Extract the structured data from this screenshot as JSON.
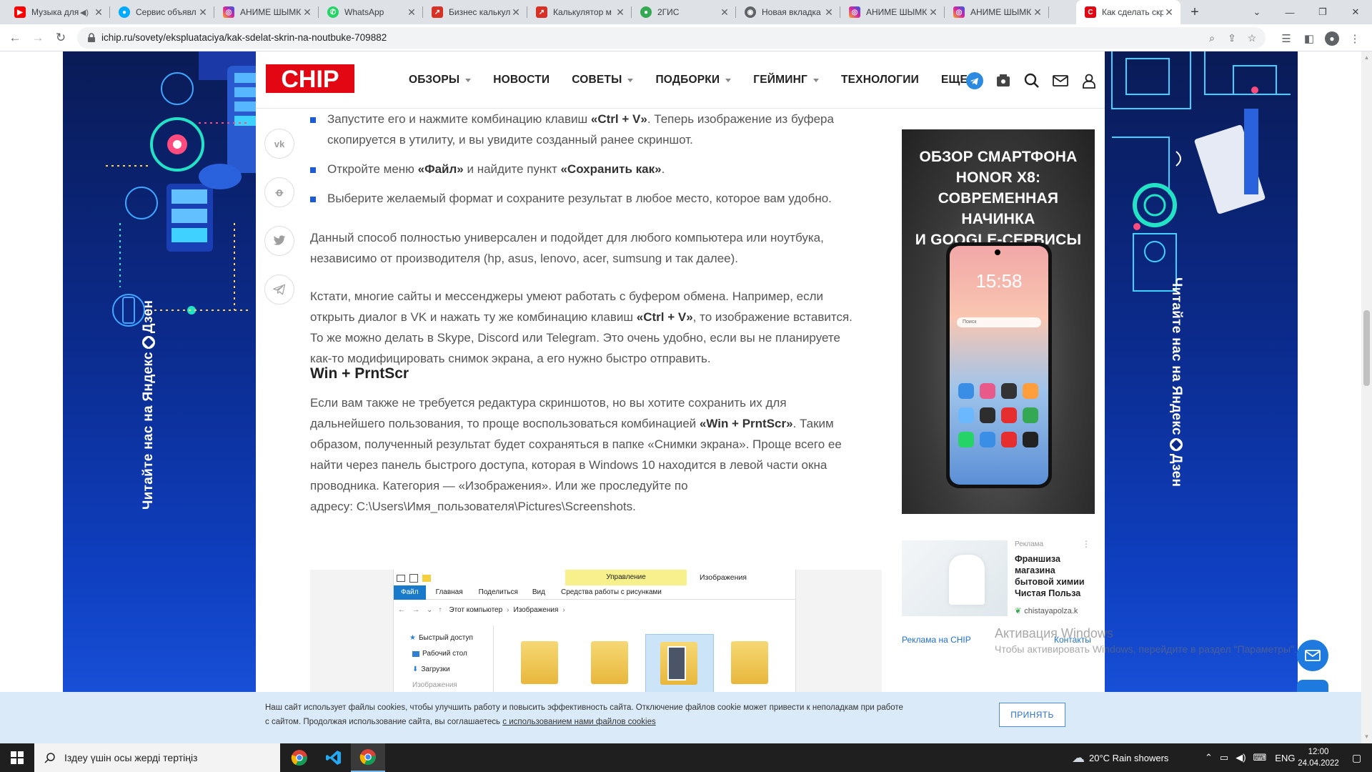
{
  "tabs": [
    {
      "title": "Музыка для",
      "icon": "youtube-icon",
      "color": "#ff0000",
      "audio": true
    },
    {
      "title": "Сервис объявл",
      "icon": "avito-icon",
      "color": "#00aaff"
    },
    {
      "title": "АНИМЕ ШЫМК",
      "icon": "instagram-icon",
      "color": "#d6249f"
    },
    {
      "title": "WhatsApp",
      "icon": "whatsapp-icon",
      "color": "#25d366"
    },
    {
      "title": "Бизнес калькул",
      "icon": "chart-icon",
      "color": "#d93025"
    },
    {
      "title": "Калькулятор м",
      "icon": "chart-icon",
      "color": "#d93025"
    },
    {
      "title": "2ГИС",
      "icon": "2gis-icon",
      "color": "#34a853"
    },
    {
      "title": "Новая вкладка",
      "icon": "chrome-icon",
      "color": "#5f6368"
    },
    {
      "title": "АНИМЕ ШЫМК",
      "icon": "instagram-icon",
      "color": "#d6249f"
    },
    {
      "title": "АНИМЕ ШЫМК",
      "icon": "instagram-icon",
      "color": "#d6249f"
    },
    {
      "title": "Как сделать скр",
      "icon": "chip-icon",
      "color": "#e30613",
      "active": true
    }
  ],
  "address_bar": {
    "url": "ichip.ru/sovety/ekspluataciya/kak-sdelat-skrin-na-noutbuke-709882"
  },
  "site": {
    "logo": "CHIP",
    "menu": [
      {
        "label": "ОБЗОРЫ",
        "dropdown": true
      },
      {
        "label": "НОВОСТИ",
        "dropdown": false
      },
      {
        "label": "СОВЕТЫ",
        "dropdown": true
      },
      {
        "label": "ПОДБОРКИ",
        "dropdown": true
      },
      {
        "label": "ГЕЙМИНГ",
        "dropdown": true
      },
      {
        "label": "ТЕХНОЛОГИИ",
        "dropdown": false
      },
      {
        "label": "ЕЩЕ",
        "dropdown": true
      }
    ],
    "brand_color": "#e30613",
    "accent_color": "#1e5bd0"
  },
  "side_banner": {
    "text_left": "Читайте нас на",
    "text_right": "Дзен",
    "brand": "Яндекс"
  },
  "share": [
    "vk-icon",
    "odnoklassniki-icon",
    "twitter-icon",
    "telegram-icon"
  ],
  "article": {
    "bullets": [
      {
        "pre": "Запустите его и нажмите комбинацию клавиш ",
        "bold": "«Ctrl + V»",
        "post": ". Теперь изображение из буфера",
        "line2": "скопируется в утилиту, и вы увидите созданный ранее скриншот."
      },
      {
        "pre": "Откройте меню ",
        "bold": "«Файл»",
        "mid": " и найдите пункт ",
        "bold2": "«Сохранить как»",
        "post": "."
      },
      {
        "text": "Выберите желаемый формат и сохраните результат в любое место, которое вам удобно."
      }
    ],
    "para1": {
      "l1": "Данный способ полностью универсален и подойдет для любого компьютера или ноутбука,",
      "l2": "независимо от производителя (hp, asus, lenovo, acer, sumsung и так далее)."
    },
    "para2": {
      "l1": "Кстати, многие сайты и мессенджеры умеют работать с буфером обмена. Например, если",
      "l2_pre": "открыть диалог в VK и нажать ту же комбинацию клавиш ",
      "l2_bold": "«Ctrl + V»",
      "l2_post": ", то изображение вставится.",
      "l3": "То же можно делать в Skype, Discord или Telegram. Это очень удобно, если вы не планируете",
      "l4": "как-то модифицировать снимок экрана, а его нужно быстро отправить."
    },
    "heading": "Win + PrntScr",
    "para3": {
      "l1": "Если вам также не требуется редактура скриншотов, но вы хотите сохранить их для",
      "l2_pre": "дальнейшего пользования, то проще воспользоваться комбинацией ",
      "l2_bold": "«Win + PrntScr»",
      "l2_post": ". Таким",
      "l3": "образом, полученный результат будет сохраняться в папке «Снимки экрана». Проще всего ее",
      "l4": "найти через панель быстрого доступа, которая в Windows 10 находится в левой части окна",
      "l5": "проводника. Категория — «Изображения». Или же проследуйте по",
      "l6": "адресу: C:\\Users\\Имя_пользователя\\Pictures\\Screenshots."
    }
  },
  "explorer": {
    "context_tab": "Управление",
    "window_title": "Изображения",
    "ribbon": [
      "Файл",
      "Главная",
      "Поделиться",
      "Вид",
      "Средства работы с рисунками"
    ],
    "path": [
      "Этот компьютер",
      "Изображения"
    ],
    "nav": [
      "Быстрый доступ",
      "Рабочий стол",
      "Загрузки",
      "Изображения"
    ]
  },
  "ads": {
    "phone_ad": {
      "l1": "ОБЗОР СМАРТФОНА",
      "l2": "HONOR X8:",
      "l3": "СОВРЕМЕННАЯ НАЧИНКА",
      "l4": "И GOOGLE-СЕРВИСЫ",
      "clock": "15:58",
      "search_hint": "Поиск"
    },
    "sponsored": {
      "label": "Реклама",
      "title": "Франшиза магазина бытовой химии Чистая Польза",
      "domain": "chistayapolza.k"
    },
    "footer_left": "Реклама на CHIP",
    "footer_right": "Контакты"
  },
  "cookie": {
    "line1": "Наш сайт использует файлы cookies, чтобы улучшить работу и повысить эффективность сайта. Отключение файлов cookie может привести к неполадкам при работе",
    "line2_pre": "с сайтом. Продолжая использование сайта, вы соглашаетесь ",
    "line2_link": "с использованием нами файлов cookies",
    "accept": "ПРИНЯТЬ"
  },
  "watermark": {
    "title": "Активация Windows",
    "sub": "Чтобы активировать Windows, перейдите в раздел \"Параметры\"."
  },
  "taskbar": {
    "search_placeholder": "Іздеу үшін осы жерді тертіңіз",
    "weather": "20°C  Rain showers",
    "lang": "ENG",
    "time": "12:00",
    "date": "24.04.2022"
  }
}
